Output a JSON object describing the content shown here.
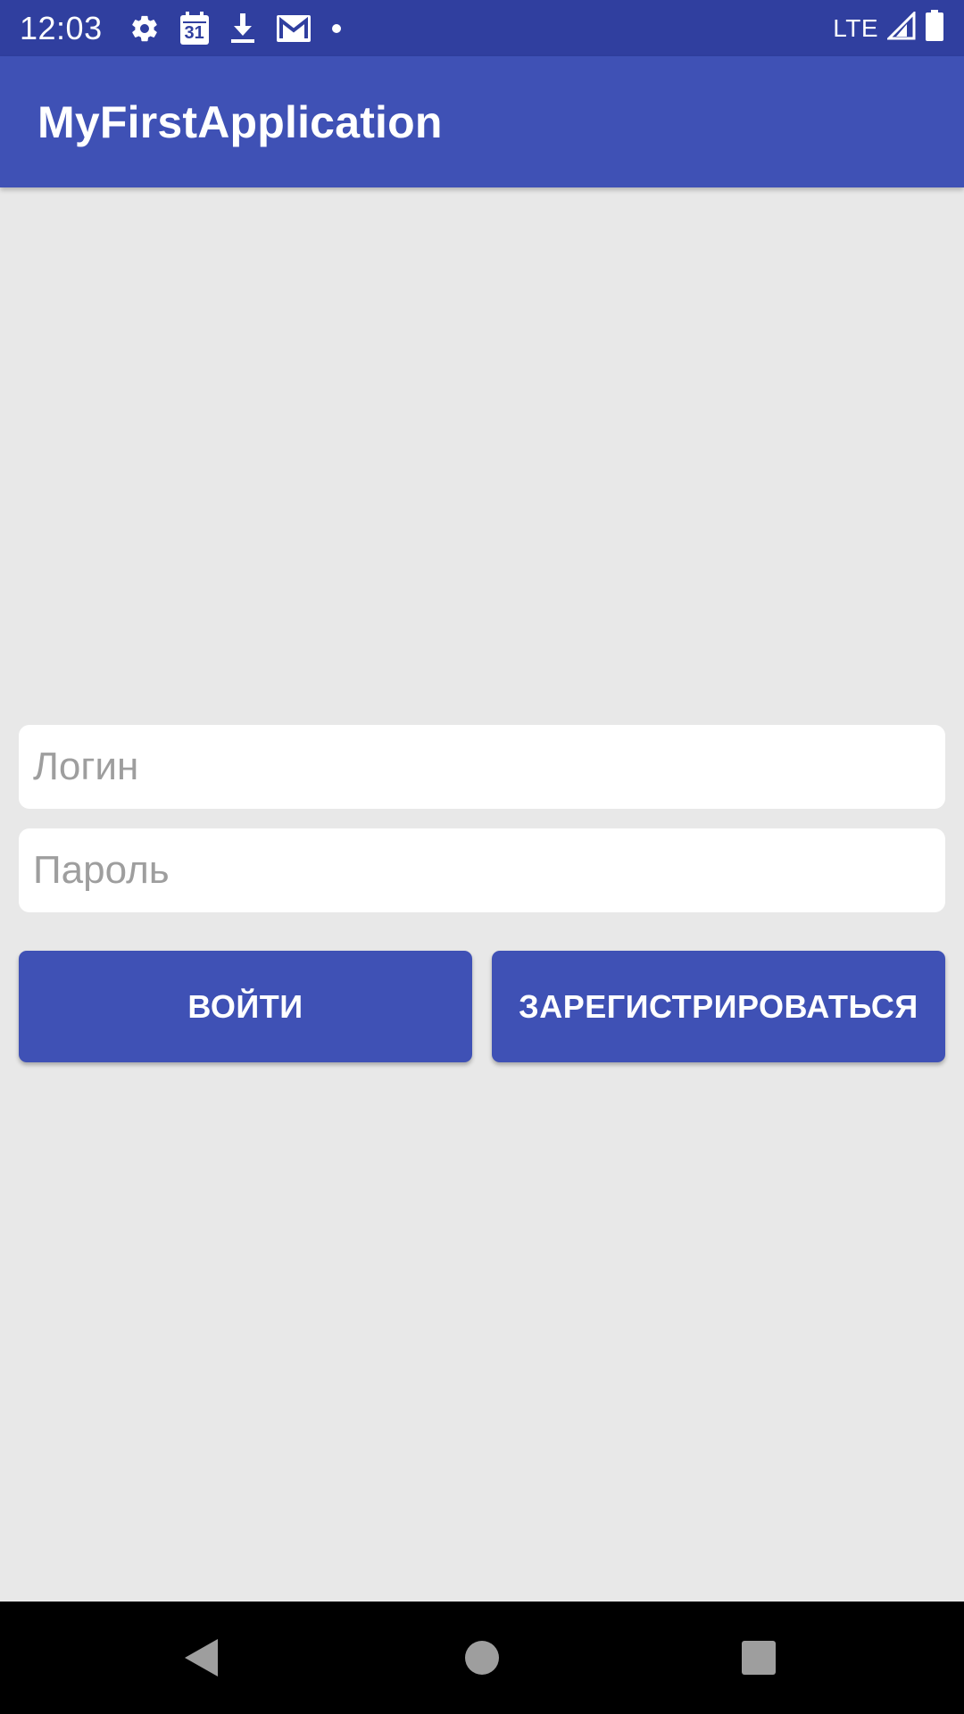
{
  "status_bar": {
    "time": "12:03",
    "icons": [
      "settings-icon",
      "calendar-icon",
      "download-icon",
      "gmail-icon",
      "notification-dot-icon"
    ],
    "calendar_day": "31",
    "network": "LTE",
    "right_icons": [
      "signal-icon",
      "battery-icon"
    ]
  },
  "app_bar": {
    "title": "MyFirstApplication"
  },
  "form": {
    "login_placeholder": "Логин",
    "login_value": "",
    "password_placeholder": "Пароль",
    "password_value": "",
    "login_button": "ВОЙТИ",
    "register_button": "ЗАРЕГИСТРИРОВАТЬСЯ"
  },
  "nav_bar": {
    "buttons": [
      "back-icon",
      "home-icon",
      "recent-apps-icon"
    ]
  },
  "colors": {
    "status_bar": "#303f9f",
    "primary": "#3f51b5",
    "background": "#e8e8e8",
    "placeholder": "#9e9e9e",
    "nav_bar": "#000000"
  }
}
